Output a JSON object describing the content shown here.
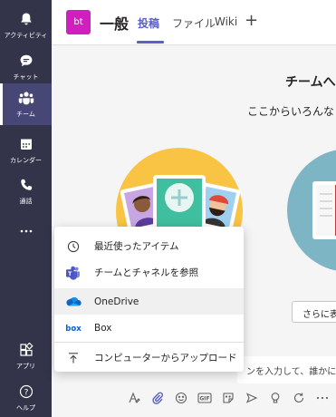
{
  "rail": {
    "items": [
      {
        "label": "アクティビティ",
        "icon": "bell-icon"
      },
      {
        "label": "チャット",
        "icon": "chat-icon"
      },
      {
        "label": "チーム",
        "icon": "teams-icon"
      },
      {
        "label": "カレンダー",
        "icon": "calendar-icon"
      },
      {
        "label": "通話",
        "icon": "phone-icon"
      },
      {
        "label": "…",
        "icon": "more-icon"
      }
    ],
    "bottom_items": [
      {
        "label": "アプリ",
        "icon": "apps-icon"
      },
      {
        "label": "ヘルプ",
        "icon": "help-icon"
      }
    ]
  },
  "header": {
    "team_initials": "bt",
    "channel_name": "一般",
    "tabs": [
      "投稿",
      "ファイル",
      "Wiki"
    ],
    "active_tab": "投稿",
    "add_tab": "+"
  },
  "main": {
    "welcome_title": "チームへ",
    "welcome_sub": "ここからいろんなこ",
    "more_button": "さらに表",
    "compose_placeholder": "ンを入力して、誰かにメン"
  },
  "menu": {
    "items": [
      {
        "label": "最近使ったアイテム",
        "icon": "clock-icon"
      },
      {
        "label": "チームとチャネルを参照",
        "icon": "teams-logo-icon"
      },
      {
        "label": "OneDrive",
        "icon": "onedrive-icon"
      },
      {
        "label": "Box",
        "icon": "box-icon"
      },
      {
        "label": "コンピューターからアップロード",
        "icon": "upload-icon"
      }
    ]
  },
  "colors": {
    "rail_bg": "#33344a",
    "accent": "#5b5fc7",
    "team_avatar": "#d11fbf"
  }
}
